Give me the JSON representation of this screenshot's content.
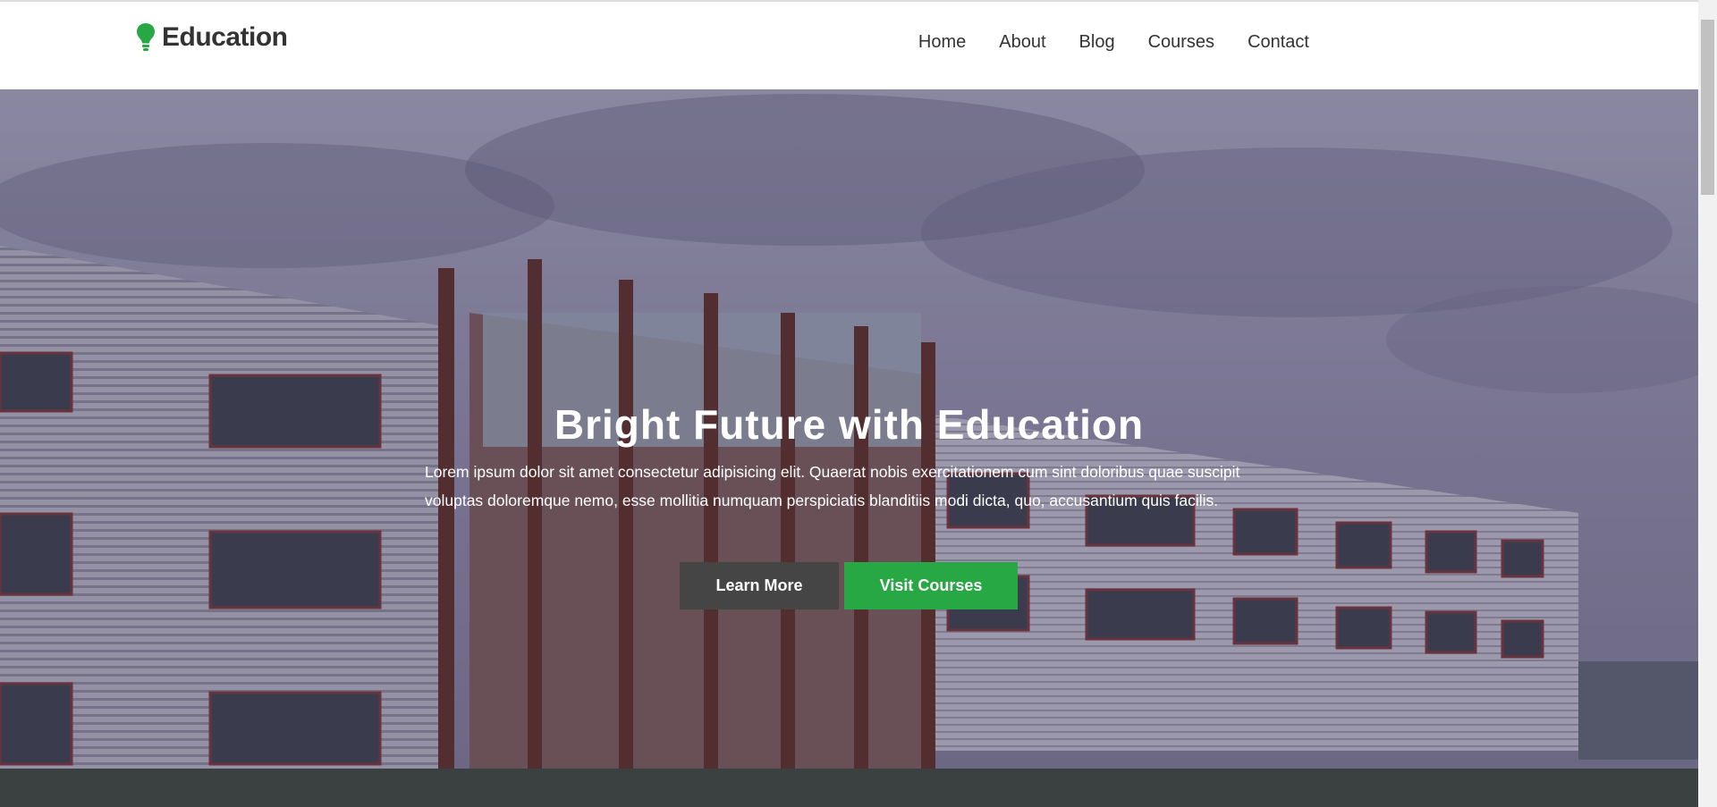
{
  "brand": {
    "name": "Education",
    "icon": "lightbulb-icon",
    "icon_color": "#28a745"
  },
  "nav": {
    "items": [
      {
        "label": "Home"
      },
      {
        "label": "About"
      },
      {
        "label": "Blog"
      },
      {
        "label": "Courses"
      },
      {
        "label": "Contact"
      }
    ]
  },
  "hero": {
    "title": "Bright Future with Education",
    "text": "Lorem ipsum dolor sit amet consectetur adipisicing elit. Quaerat nobis exercitationem cum sint doloribus quae suscipit voluptas doloremque nemo, esse mollitia numquam perspiciatis blanditiis modi dicta, quo, accusantium quis facilis.",
    "buttons": {
      "learn_more": "Learn More",
      "visit_courses": "Visit Courses"
    }
  },
  "colors": {
    "accent": "#28a745",
    "dark_button": "#454545",
    "text": "#333333"
  }
}
